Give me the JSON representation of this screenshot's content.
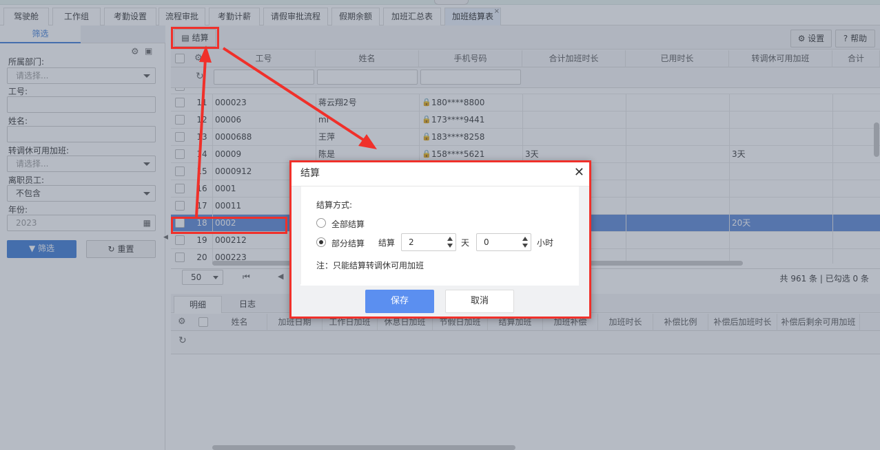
{
  "tabs": [
    "驾驶舱",
    "工作组",
    "考勤设置",
    "流程审批",
    "考勤计薪",
    "请假审批流程",
    "假期余额",
    "加班汇总表",
    "加班结算表"
  ],
  "active_tab_close": "×",
  "sidebar": {
    "tab_label": "筛选",
    "fields": [
      {
        "label": "所属部门:",
        "value": "请选择...",
        "type": "select"
      },
      {
        "label": "工号:",
        "value": "",
        "type": "text"
      },
      {
        "label": "姓名:",
        "value": "",
        "type": "text"
      },
      {
        "label": "转调休可用加班:",
        "value": "请选择...",
        "type": "select"
      },
      {
        "label": "离职员工:",
        "value": "不包含",
        "type": "select"
      },
      {
        "label": "年份:",
        "value": "2023",
        "type": "date"
      }
    ],
    "filter_button": "筛选",
    "reset_button": "重置"
  },
  "toolbar": {
    "settle": "结算",
    "settings": "设置",
    "help": "帮助"
  },
  "grid": {
    "columns": [
      "工号",
      "姓名",
      "手机号码",
      "合计加班时长",
      "已用时长",
      "转调休可用加班",
      "合计"
    ],
    "rows": [
      {
        "no": "11",
        "id": "000023",
        "name": "蒋云翔2号",
        "phone": "180****8800",
        "total": "",
        "used": "",
        "avail": ""
      },
      {
        "no": "12",
        "id": "00006",
        "name": "ml",
        "phone": "173****9441",
        "total": "",
        "used": "",
        "avail": ""
      },
      {
        "no": "13",
        "id": "0000688",
        "name": "王萍",
        "phone": "183****8258",
        "total": "",
        "used": "",
        "avail": ""
      },
      {
        "no": "14",
        "id": "00009",
        "name": "陈是",
        "phone": "158****5621",
        "total": "3天",
        "used": "",
        "avail": "3天"
      },
      {
        "no": "15",
        "id": "0000912",
        "name": "",
        "phone": "",
        "total": "",
        "used": "",
        "avail": ""
      },
      {
        "no": "16",
        "id": "0001",
        "name": "",
        "phone": "",
        "total": "",
        "used": "",
        "avail": ""
      },
      {
        "no": "17",
        "id": "00011",
        "name": "",
        "phone": "",
        "total": "",
        "used": "",
        "avail": ""
      },
      {
        "no": "18",
        "id": "0002",
        "name": "",
        "phone": "",
        "total": "",
        "used": "",
        "avail": "20天"
      },
      {
        "no": "19",
        "id": "000212",
        "name": "",
        "phone": "",
        "total": "",
        "used": "",
        "avail": ""
      },
      {
        "no": "20",
        "id": "000223",
        "name": "",
        "phone": "",
        "total": "",
        "used": "",
        "avail": ""
      }
    ],
    "page_size": "50",
    "footer": "共 961 条 | 已勾选 0 条"
  },
  "detail": {
    "tabs": [
      "明细",
      "日志"
    ],
    "columns": [
      "姓名",
      "加班日期",
      "工作日加班",
      "休息日加班",
      "节假日加班",
      "结算加班",
      "加班补偿",
      "加班时长",
      "补偿比例",
      "补偿后加班时长",
      "补偿后剩余可用加班"
    ]
  },
  "dialog": {
    "title": "结算",
    "close": "✕",
    "mode_label": "结算方式:",
    "option_all": "全部结算",
    "option_partial": "部分结算",
    "settle_label": "结算",
    "days_value": "2",
    "days_unit": "天",
    "hours_value": "0",
    "hours_unit": "小时",
    "note": "注：只能结算转调休可用加班",
    "save": "保存",
    "cancel": "取消"
  },
  "colors": {
    "accent": "#5b87d6",
    "annotation": "#f0302a"
  }
}
